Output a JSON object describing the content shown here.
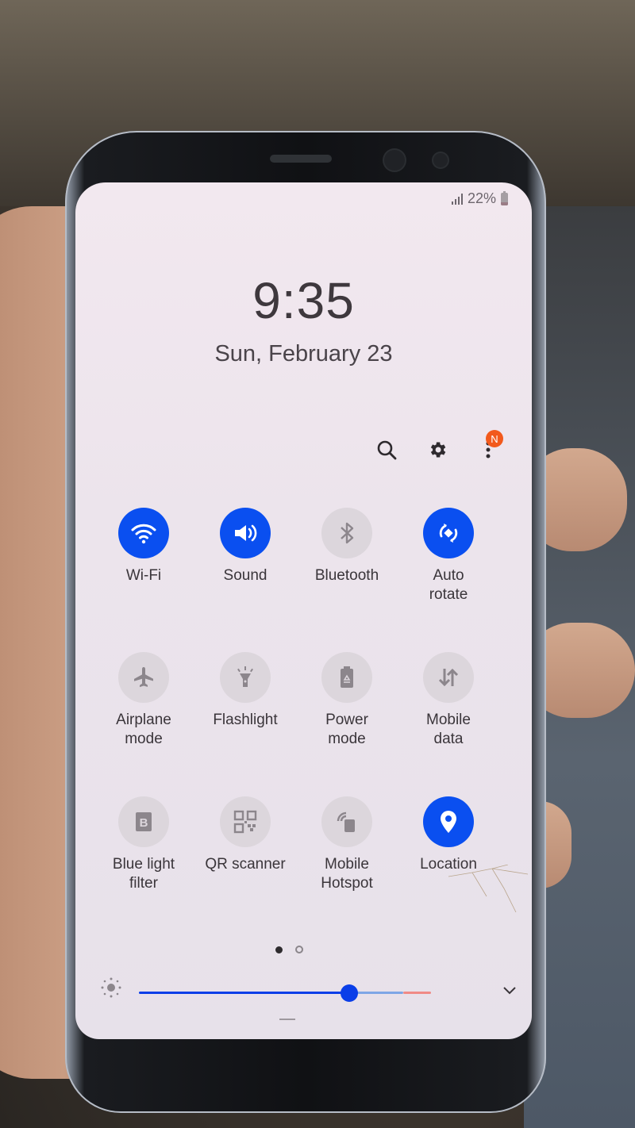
{
  "status_bar": {
    "battery_percent": "22%",
    "signal_icon": "signal-icon",
    "battery_icon": "battery-icon"
  },
  "lockscreen": {
    "time": "9:35",
    "date": "Sun, February 23"
  },
  "top_actions": [
    {
      "name": "search",
      "icon": "search-icon"
    },
    {
      "name": "settings",
      "icon": "gear-icon"
    },
    {
      "name": "more-options",
      "icon": "more-vert-icon",
      "badge": "N"
    }
  ],
  "quick_settings": {
    "rows": [
      [
        {
          "label": "Wi-Fi",
          "icon": "wifi-icon",
          "state": "on"
        },
        {
          "label": "Sound",
          "icon": "volume-icon",
          "state": "on"
        },
        {
          "label": "Bluetooth",
          "icon": "bluetooth-icon",
          "state": "off"
        },
        {
          "label": "Auto\nrotate",
          "icon": "auto-rotate-icon",
          "state": "on"
        }
      ],
      [
        {
          "label": "Airplane\nmode",
          "icon": "airplane-icon",
          "state": "off"
        },
        {
          "label": "Flashlight",
          "icon": "flashlight-icon",
          "state": "off"
        },
        {
          "label": "Power\nmode",
          "icon": "power-mode-icon",
          "state": "off"
        },
        {
          "label": "Mobile\ndata",
          "icon": "mobile-data-icon",
          "state": "off"
        }
      ],
      [
        {
          "label": "Blue light\nfilter",
          "icon": "blue-light-filter-icon",
          "state": "off"
        },
        {
          "label": "QR scanner",
          "icon": "qr-code-icon",
          "state": "off"
        },
        {
          "label": "Mobile\nHotspot",
          "icon": "hotspot-icon",
          "state": "off"
        },
        {
          "label": "Location",
          "icon": "location-icon",
          "state": "on"
        }
      ]
    ]
  },
  "pager": {
    "current_page": 1,
    "total_pages": 2
  },
  "brightness": {
    "value_fraction": 0.72,
    "icon": "brightness-icon",
    "expand_icon": "chevron-down-icon"
  },
  "colors": {
    "accent": "#0a4ff0",
    "tile_off": "#dcd6dc",
    "badge": "#f2591c",
    "slider_active": "#0a3ee8",
    "slider_inactive": "#7ea6e6",
    "slider_warn": "#f08a86"
  }
}
